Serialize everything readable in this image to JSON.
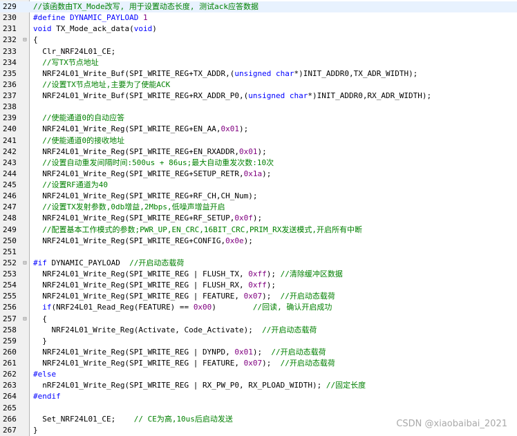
{
  "editor": {
    "lines": [
      {
        "n": "229",
        "fold": "",
        "segs": [
          {
            "t": "//该函数由TX_Mode改写, 用于设置动态长度, 测试ack应答数据",
            "c": "cm"
          }
        ],
        "hl": true
      },
      {
        "n": "230",
        "fold": "",
        "segs": [
          {
            "t": "#define DYNAMIC_PAYLOAD ",
            "c": "pp"
          },
          {
            "t": "1",
            "c": "num"
          }
        ]
      },
      {
        "n": "231",
        "fold": "",
        "segs": [
          {
            "t": "void",
            "c": "kw"
          },
          {
            "t": " TX_Mode_ack_data(",
            "c": ""
          },
          {
            "t": "void",
            "c": "kw"
          },
          {
            "t": ")",
            "c": ""
          }
        ]
      },
      {
        "n": "232",
        "fold": "⊟",
        "segs": [
          {
            "t": "{",
            "c": ""
          }
        ]
      },
      {
        "n": "233",
        "fold": "",
        "segs": [
          {
            "t": "  Clr_NRF24L01_CE;",
            "c": ""
          }
        ]
      },
      {
        "n": "234",
        "fold": "",
        "segs": [
          {
            "t": "  //写TX节点地址",
            "c": "cm"
          }
        ]
      },
      {
        "n": "235",
        "fold": "",
        "segs": [
          {
            "t": "  NRF24L01_Write_Buf(SPI_WRITE_REG+TX_ADDR,(",
            "c": ""
          },
          {
            "t": "unsigned char",
            "c": "ty"
          },
          {
            "t": "*)INIT_ADDR0,TX_ADR_WIDTH);",
            "c": ""
          }
        ]
      },
      {
        "n": "236",
        "fold": "",
        "segs": [
          {
            "t": "  //设置TX节点地址,主要为了使能ACK",
            "c": "cm"
          }
        ]
      },
      {
        "n": "237",
        "fold": "",
        "segs": [
          {
            "t": "  NRF24L01_Write_Buf(SPI_WRITE_REG+RX_ADDR_P0,(",
            "c": ""
          },
          {
            "t": "unsigned char",
            "c": "ty"
          },
          {
            "t": "*)INIT_ADDR0,RX_ADR_WIDTH);",
            "c": ""
          }
        ]
      },
      {
        "n": "238",
        "fold": "",
        "segs": [
          {
            "t": "",
            "c": ""
          }
        ]
      },
      {
        "n": "239",
        "fold": "",
        "segs": [
          {
            "t": "  //使能通道0的自动应答",
            "c": "cm"
          }
        ]
      },
      {
        "n": "240",
        "fold": "",
        "segs": [
          {
            "t": "  NRF24L01_Write_Reg(SPI_WRITE_REG+EN_AA,",
            "c": ""
          },
          {
            "t": "0x01",
            "c": "num"
          },
          {
            "t": ");",
            "c": ""
          }
        ]
      },
      {
        "n": "241",
        "fold": "",
        "segs": [
          {
            "t": "  //使能通道0的接收地址",
            "c": "cm"
          }
        ]
      },
      {
        "n": "242",
        "fold": "",
        "segs": [
          {
            "t": "  NRF24L01_Write_Reg(SPI_WRITE_REG+EN_RXADDR,",
            "c": ""
          },
          {
            "t": "0x01",
            "c": "num"
          },
          {
            "t": ");",
            "c": ""
          }
        ]
      },
      {
        "n": "243",
        "fold": "",
        "segs": [
          {
            "t": "  //设置自动重发间隔时间:500us + 86us;最大自动重发次数:10次",
            "c": "cm"
          }
        ]
      },
      {
        "n": "244",
        "fold": "",
        "segs": [
          {
            "t": "  NRF24L01_Write_Reg(SPI_WRITE_REG+SETUP_RETR,",
            "c": ""
          },
          {
            "t": "0x1a",
            "c": "num"
          },
          {
            "t": ");",
            "c": ""
          }
        ]
      },
      {
        "n": "245",
        "fold": "",
        "segs": [
          {
            "t": "  //设置RF通道为40",
            "c": "cm"
          }
        ]
      },
      {
        "n": "246",
        "fold": "",
        "segs": [
          {
            "t": "  NRF24L01_Write_Reg(SPI_WRITE_REG+RF_CH,CH_Num);",
            "c": ""
          }
        ]
      },
      {
        "n": "247",
        "fold": "",
        "segs": [
          {
            "t": "  //设置TX发射参数,0db增益,2Mbps,低噪声增益开启",
            "c": "cm"
          }
        ]
      },
      {
        "n": "248",
        "fold": "",
        "segs": [
          {
            "t": "  NRF24L01_Write_Reg(SPI_WRITE_REG+RF_SETUP,",
            "c": ""
          },
          {
            "t": "0x0f",
            "c": "num"
          },
          {
            "t": ");",
            "c": ""
          }
        ]
      },
      {
        "n": "249",
        "fold": "",
        "segs": [
          {
            "t": "  //配置基本工作模式的参数;PWR_UP,EN_CRC,16BIT_CRC,PRIM_RX发送模式,开启所有中断",
            "c": "cm"
          }
        ]
      },
      {
        "n": "250",
        "fold": "",
        "segs": [
          {
            "t": "  NRF24L01_Write_Reg(SPI_WRITE_REG+CONFIG,",
            "c": ""
          },
          {
            "t": "0x0e",
            "c": "num"
          },
          {
            "t": ");",
            "c": ""
          }
        ]
      },
      {
        "n": "251",
        "fold": "",
        "segs": [
          {
            "t": "",
            "c": ""
          }
        ]
      },
      {
        "n": "252",
        "fold": "⊟",
        "segs": [
          {
            "t": "#if",
            "c": "pp"
          },
          {
            "t": " DYNAMIC_PAYLOAD  ",
            "c": ""
          },
          {
            "t": "//开启动态载荷",
            "c": "cm"
          }
        ]
      },
      {
        "n": "253",
        "fold": "",
        "segs": [
          {
            "t": "  NRF24L01_Write_Reg(SPI_WRITE_REG | FLUSH_TX, ",
            "c": ""
          },
          {
            "t": "0xff",
            "c": "num"
          },
          {
            "t": "); ",
            "c": ""
          },
          {
            "t": "//清除缓冲区数据",
            "c": "cm"
          }
        ]
      },
      {
        "n": "254",
        "fold": "",
        "segs": [
          {
            "t": "  NRF24L01_Write_Reg(SPI_WRITE_REG | FLUSH_RX, ",
            "c": ""
          },
          {
            "t": "0xff",
            "c": "num"
          },
          {
            "t": ");",
            "c": ""
          }
        ]
      },
      {
        "n": "255",
        "fold": "",
        "segs": [
          {
            "t": "  NRF24L01_Write_Reg(SPI_WRITE_REG | FEATURE, ",
            "c": ""
          },
          {
            "t": "0x07",
            "c": "num"
          },
          {
            "t": ");  ",
            "c": ""
          },
          {
            "t": "//开启动态载荷",
            "c": "cm"
          }
        ]
      },
      {
        "n": "256",
        "fold": "",
        "segs": [
          {
            "t": "  ",
            "c": ""
          },
          {
            "t": "if",
            "c": "kw"
          },
          {
            "t": "(NRF24L01_Read_Reg(FEATURE) == ",
            "c": ""
          },
          {
            "t": "0x00",
            "c": "num"
          },
          {
            "t": ")        ",
            "c": ""
          },
          {
            "t": "//回读, 确认开启成功",
            "c": "cm"
          }
        ]
      },
      {
        "n": "257",
        "fold": "⊟",
        "segs": [
          {
            "t": "  {",
            "c": ""
          }
        ]
      },
      {
        "n": "258",
        "fold": "",
        "segs": [
          {
            "t": "    NRF24L01_Write_Reg(Activate, Code_Activate);  ",
            "c": ""
          },
          {
            "t": "//开启动态载荷",
            "c": "cm"
          }
        ]
      },
      {
        "n": "259",
        "fold": "",
        "segs": [
          {
            "t": "  }",
            "c": ""
          }
        ]
      },
      {
        "n": "260",
        "fold": "",
        "segs": [
          {
            "t": "  NRF24L01_Write_Reg(SPI_WRITE_REG | DYNPD, ",
            "c": ""
          },
          {
            "t": "0x01",
            "c": "num"
          },
          {
            "t": ");  ",
            "c": ""
          },
          {
            "t": "//开启动态载荷",
            "c": "cm"
          }
        ]
      },
      {
        "n": "261",
        "fold": "",
        "segs": [
          {
            "t": "  NRF24L01_Write_Reg(SPI_WRITE_REG | FEATURE, ",
            "c": ""
          },
          {
            "t": "0x07",
            "c": "num"
          },
          {
            "t": ");  ",
            "c": ""
          },
          {
            "t": "//开启动态载荷",
            "c": "cm"
          }
        ]
      },
      {
        "n": "262",
        "fold": "",
        "segs": [
          {
            "t": "#else",
            "c": "pp"
          }
        ]
      },
      {
        "n": "263",
        "fold": "",
        "segs": [
          {
            "t": "  nRF24L01_Write_Reg(SPI_WRITE_REG | RX_PW_P0, RX_PLOAD_WIDTH); ",
            "c": ""
          },
          {
            "t": "//固定长度",
            "c": "cm"
          }
        ]
      },
      {
        "n": "264",
        "fold": "",
        "segs": [
          {
            "t": "#endif",
            "c": "pp"
          }
        ]
      },
      {
        "n": "265",
        "fold": "",
        "segs": [
          {
            "t": "",
            "c": ""
          }
        ]
      },
      {
        "n": "266",
        "fold": "",
        "segs": [
          {
            "t": "  Set_NRF24L01_CE;    ",
            "c": ""
          },
          {
            "t": "// CE为高,10us后启动发送",
            "c": "cm"
          }
        ]
      },
      {
        "n": "267",
        "fold": "",
        "segs": [
          {
            "t": "}",
            "c": ""
          }
        ]
      }
    ]
  },
  "watermark": "CSDN @xiaobaibai_2021"
}
